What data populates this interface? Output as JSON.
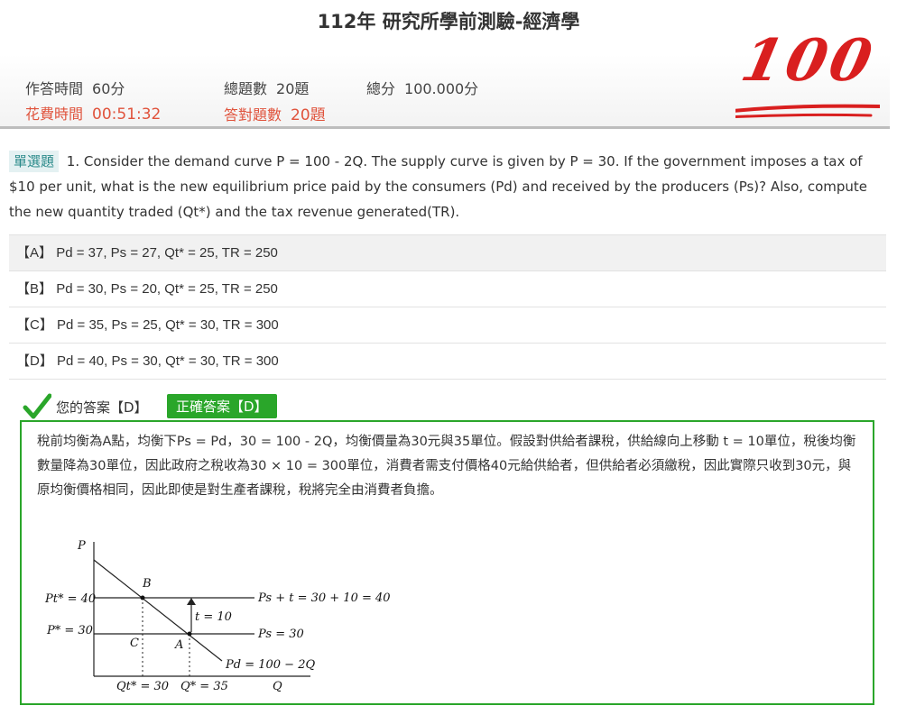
{
  "page_title": "112年 研究所學前測驗-經濟學",
  "header": {
    "answer_time_label": "作答時間",
    "answer_time_value": "60分",
    "total_questions_label": "總題數",
    "total_questions_value": "20題",
    "total_score_label": "總分",
    "total_score_value": "100.000分",
    "time_spent_label": "花費時間",
    "time_spent_value": "00:51:32",
    "correct_count_label": "答對題數",
    "correct_count_value": "20題",
    "score_stamp": "100"
  },
  "question": {
    "type_tag": "單選題",
    "number": "1.",
    "text": "Consider the demand curve P = 100 - 2Q. The supply curve is given by P = 30. If the government imposes a tax of $10 per unit, what is the new equilibrium price paid by the consumers (Pd) and received by the producers (Ps)? Also, compute the new quantity traded (Qt*) and the tax revenue generated(TR).",
    "options": [
      {
        "key": "【A】",
        "text": "Pd = 37, Ps = 27, Qt* = 25, TR = 250"
      },
      {
        "key": "【B】",
        "text": "Pd = 30, Ps = 20, Qt* = 25, TR = 250"
      },
      {
        "key": "【C】",
        "text": "Pd = 35, Ps = 25, Qt* = 30, TR = 300"
      },
      {
        "key": "【D】",
        "text": "Pd = 40, Ps = 30, Qt* = 30, TR = 300"
      }
    ]
  },
  "answer": {
    "your_answer": "您的答案【D】",
    "correct_answer": "正確答案【D】"
  },
  "explanation": {
    "text": "稅前均衡為A點，均衡下Ps = Pd，30 = 100 - 2Q，均衡價量為30元與35單位。假設對供給者課稅，供給線向上移動 t = 10單位，稅後均衡數量降為30單位，因此政府之稅收為30 × 10 = 300單位，消費者需支付價格40元給供給者，但供給者必須繳稅，因此實際只收到30元，與原均衡價格相同，因此即使是對生產者課稅，稅將完全由消費者負擔。",
    "graph": {
      "y_axis": "P",
      "x_axis": "Q",
      "label_pt": "Pt* = 40",
      "label_p": "P* = 30",
      "point_b": "B",
      "point_c": "C",
      "point_a": "A",
      "label_ps_t": "Ps + t = 30 + 10 = 40",
      "label_t": "t = 10",
      "label_ps": "Ps = 30",
      "label_pd": "Pd = 100 − 2Q",
      "label_qt": "Qt* = 30",
      "label_q": "Q* = 35"
    }
  },
  "colors": {
    "accent_red": "#e0533c",
    "stamp_red": "#d91f1f",
    "correct_green": "#2aa62a",
    "tag_bg": "#e4f1f2"
  }
}
